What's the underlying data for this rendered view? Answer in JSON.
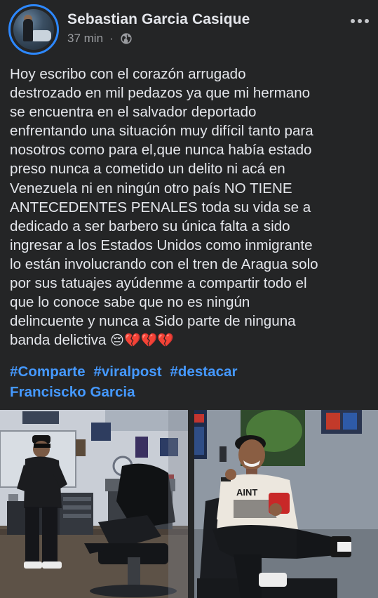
{
  "post": {
    "author": "Sebastian Garcia Casique",
    "time": "37 min",
    "separator": "·",
    "privacy_icon": "globe-icon",
    "more_icon": "more-horizontal-icon",
    "body_lines": [
      "Hoy escribo con el corazón arrugado",
      "destrozado en mil pedazos ya que mi hermano",
      "se encuentra en el salvador deportado",
      "enfrentando una situación muy difícil tanto para",
      "nosotros como para el,que nunca había estado",
      "preso nunca a cometido un delito ni acá en",
      "Venezuela ni en ningún otro país NO TIENE",
      "ANTECEDENTES PENALES toda su vida se a",
      "dedicado a ser barbero su única falta a sido",
      "ingresar a los Estados Unidos como inmigrante",
      "lo están involucrando con el tren de Aragua solo",
      "por sus tatuajes ayúdenme a compartir todo el",
      "que lo conoce sabe que no es ningún",
      "delincuente y nunca a Sido parte de ninguna",
      "banda delictiva"
    ],
    "emojis": [
      "😔",
      "💔",
      "💔",
      "💔"
    ],
    "hashtags": [
      "#Comparte",
      "#viralpost",
      "#destacar"
    ],
    "mention": "Francisckо Garcia"
  },
  "photos": {
    "left_name": "barbershop-photo-1",
    "right_name": "barbershop-photo-2",
    "right_shirt_text": "AINT"
  },
  "colors": {
    "background": "#242526",
    "text": "#e4e6eb",
    "muted": "#9a9ca0",
    "link": "#4599ff",
    "avatar_ring": "#2d88ff"
  }
}
